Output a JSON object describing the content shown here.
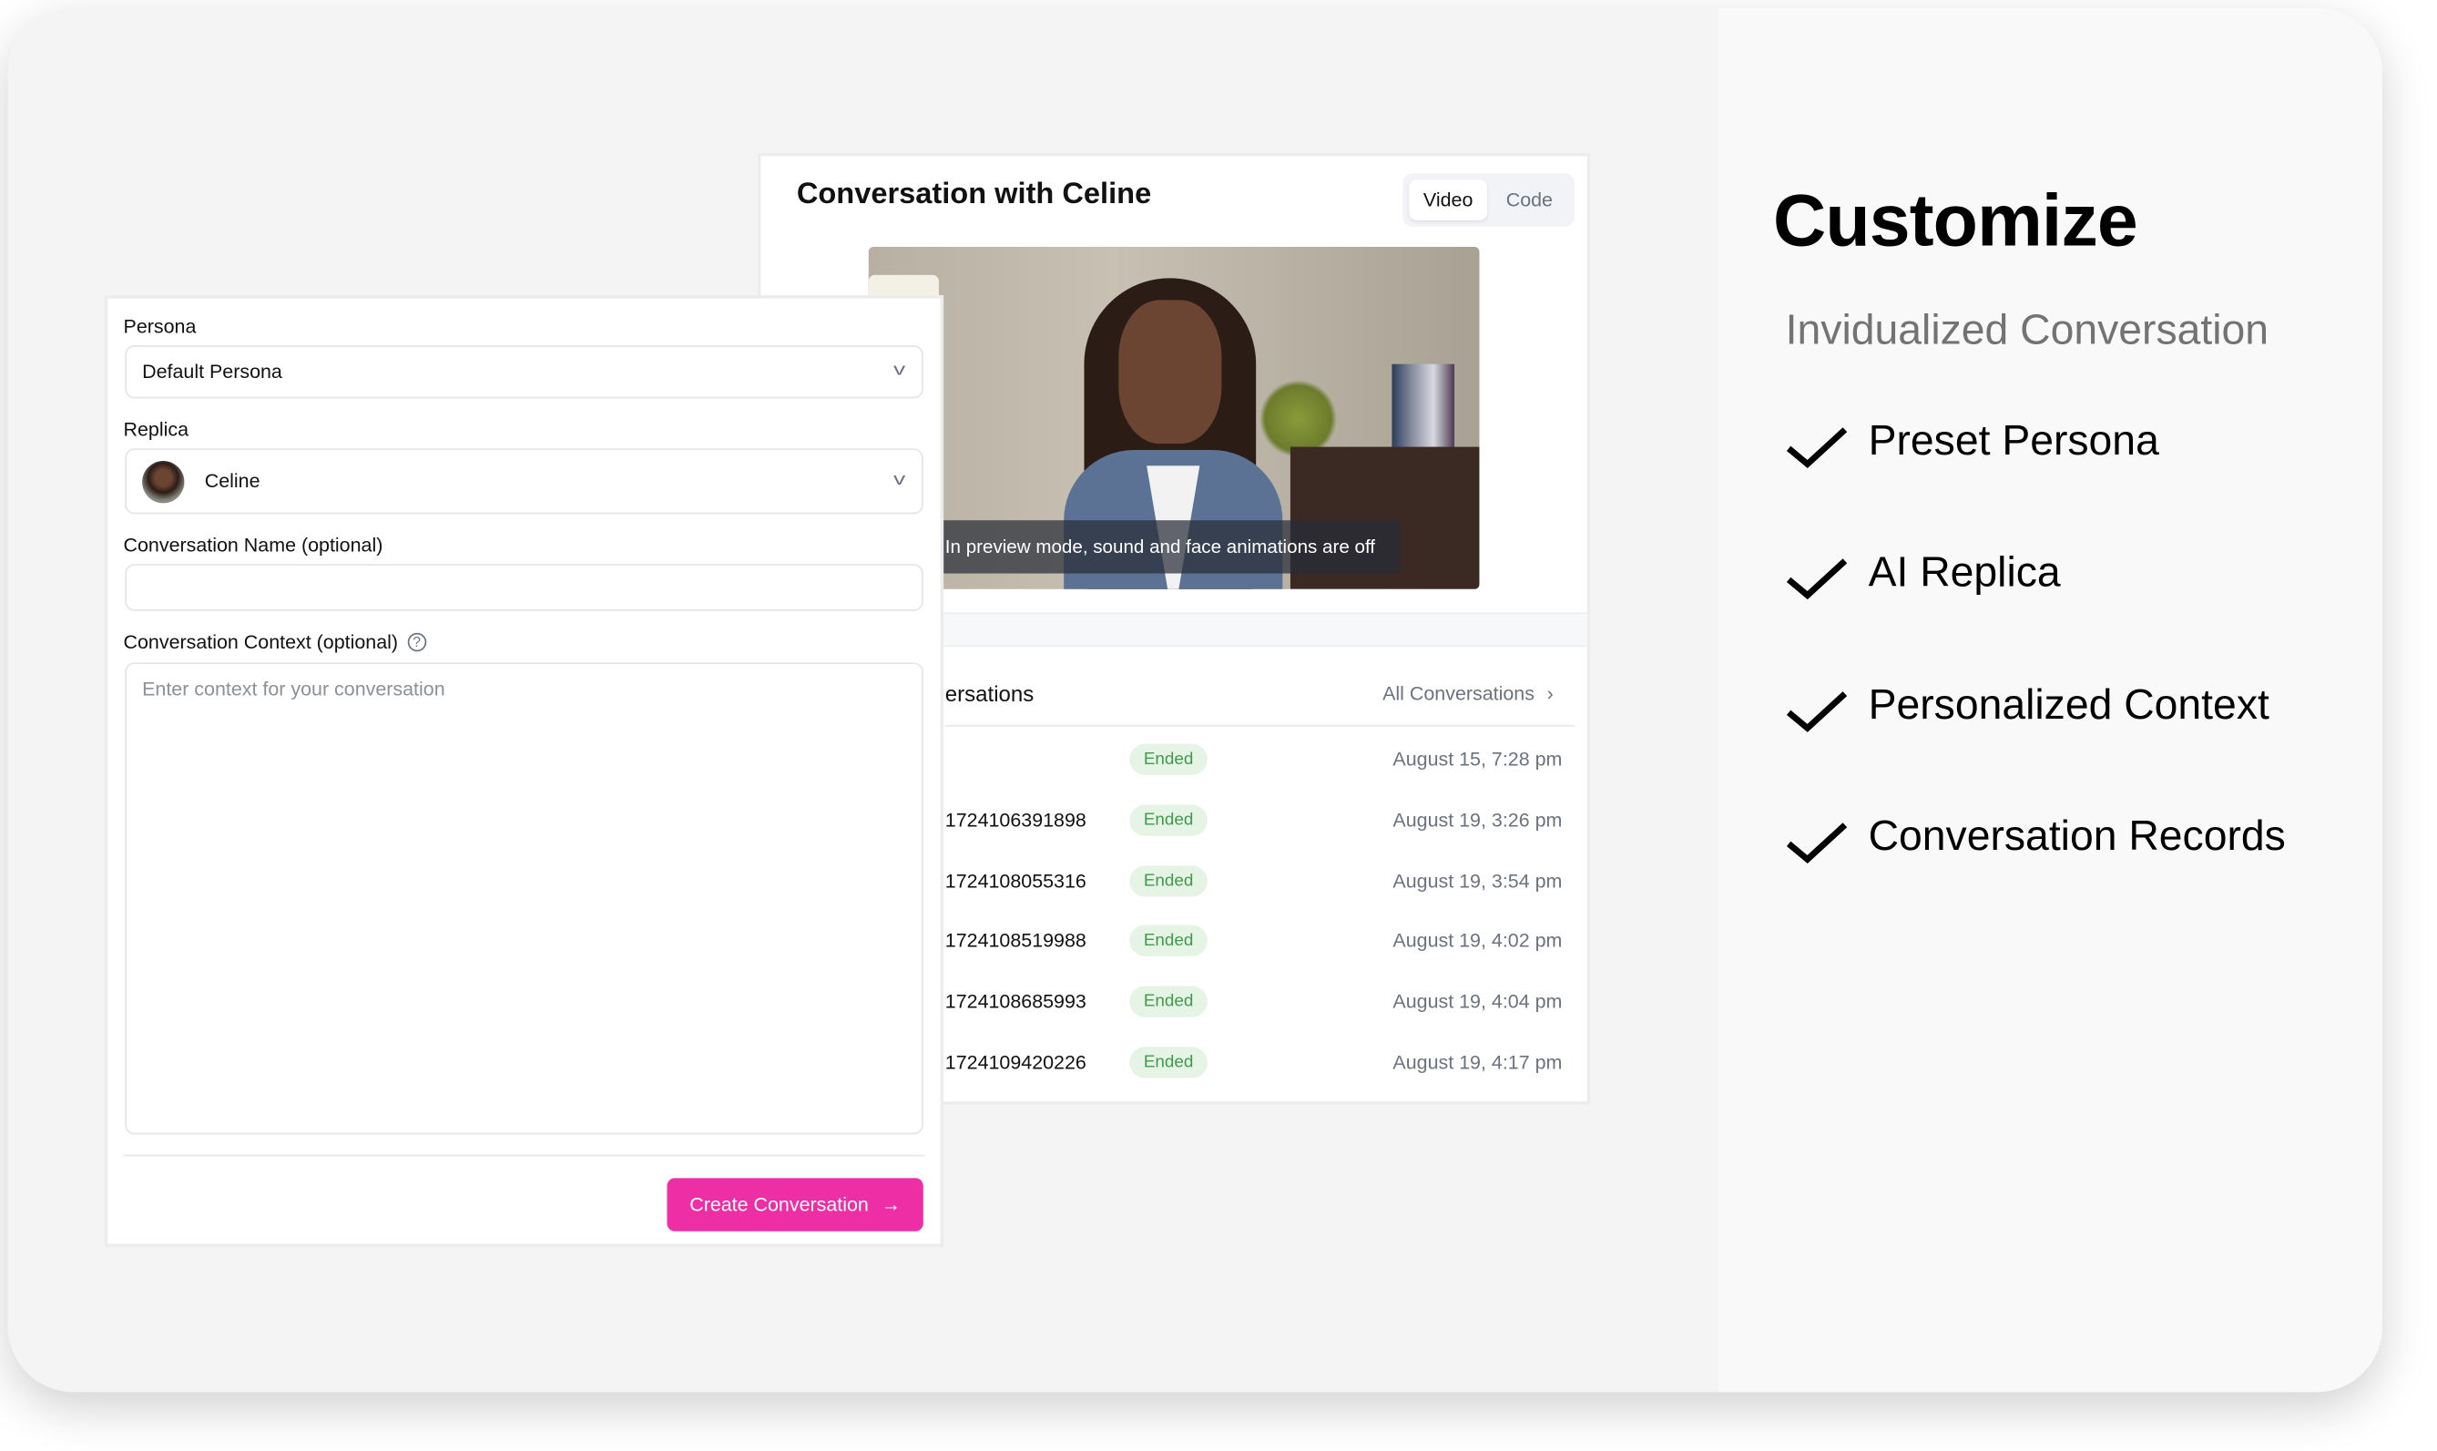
{
  "conversation_panel": {
    "title": "Conversation with Celine",
    "tabs": [
      {
        "label": "Video",
        "active": true
      },
      {
        "label": "Code",
        "active": false
      }
    ],
    "video_caption": "In preview mode, sound and face animations are off",
    "list_title": "ersations",
    "all_link": "All Conversations",
    "rows": [
      {
        "id": "",
        "status": "Ended",
        "date": "August 15, 7:28 pm"
      },
      {
        "id": "1724106391898",
        "status": "Ended",
        "date": "August 19, 3:26 pm"
      },
      {
        "id": "1724108055316",
        "status": "Ended",
        "date": "August 19, 3:54 pm"
      },
      {
        "id": "1724108519988",
        "status": "Ended",
        "date": "August 19, 4:02 pm"
      },
      {
        "id": "1724108685993",
        "status": "Ended",
        "date": "August 19, 4:04 pm"
      },
      {
        "id": "1724109420226",
        "status": "Ended",
        "date": "August 19, 4:17 pm"
      }
    ]
  },
  "form": {
    "persona_label": "Persona",
    "persona_value": "Default Persona",
    "replica_label": "Replica",
    "replica_value": "Celine",
    "name_label": "Conversation Name (optional)",
    "name_value": "",
    "context_label": "Conversation Context (optional)",
    "context_placeholder": "Enter context for your conversation",
    "submit_label": "Create Conversation"
  },
  "promo": {
    "title": "Customize",
    "subtitle": "Invidualized Conversation",
    "features": [
      "Preset Persona",
      "AI Replica",
      "Personalized Context",
      "Conversation Records"
    ]
  },
  "colors": {
    "accent": "#ee2ea5",
    "badge_bg": "#e6f4e6",
    "badge_text": "#3f9a4a"
  }
}
